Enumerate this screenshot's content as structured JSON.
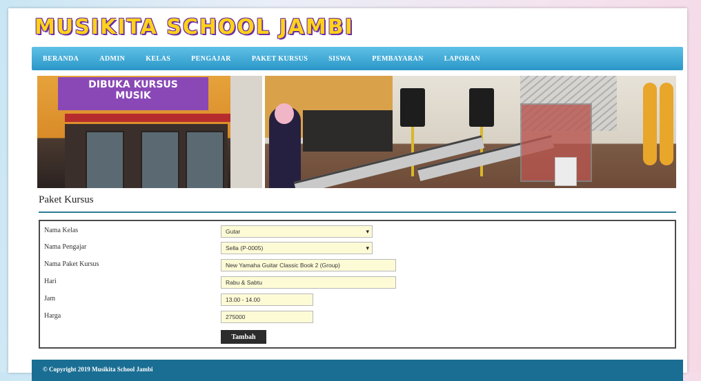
{
  "site": {
    "logo_text": "MUSIKITA SCHOOL JAMBI"
  },
  "nav": {
    "items": [
      {
        "label": "BERANDA"
      },
      {
        "label": "ADMIN"
      },
      {
        "label": "KELAS"
      },
      {
        "label": "PENGAJAR"
      },
      {
        "label": "PAKET KURSUS"
      },
      {
        "label": "SISWA"
      },
      {
        "label": "PEMBAYARAN"
      },
      {
        "label": "LAPORAN"
      }
    ]
  },
  "banner": {
    "sign_line1": "DIBUKA KURSUS",
    "sign_line2": "MUSIK"
  },
  "page": {
    "title": "Paket Kursus"
  },
  "form": {
    "nama_kelas": {
      "label": "Nama Kelas",
      "value": "Gutar"
    },
    "nama_pengajar": {
      "label": "Nama Pengajar",
      "value": "Sella (P-0005)"
    },
    "nama_paket": {
      "label": "Nama Paket Kursus",
      "value": "New Yamaha Guitar Classic Book 2 (Group)"
    },
    "hari": {
      "label": "Hari",
      "value": "Rabu & Sabtu"
    },
    "jam": {
      "label": "Jam",
      "value": "13.00 - 14.00"
    },
    "harga": {
      "label": "Harga",
      "value": "275000"
    },
    "submit_label": "Tambah"
  },
  "footer": {
    "text": "© Copyright 2019 Musikita School Jambi"
  },
  "colors": {
    "nav_bg": "#2b97c8",
    "footer_bg": "#1a6e93",
    "accent_rule": "#2a7d94",
    "input_bg": "#fdfbd6",
    "button_bg": "#2c2c2c",
    "logo_fill": "#ffd21a",
    "logo_outline": "#6a2ea6"
  }
}
